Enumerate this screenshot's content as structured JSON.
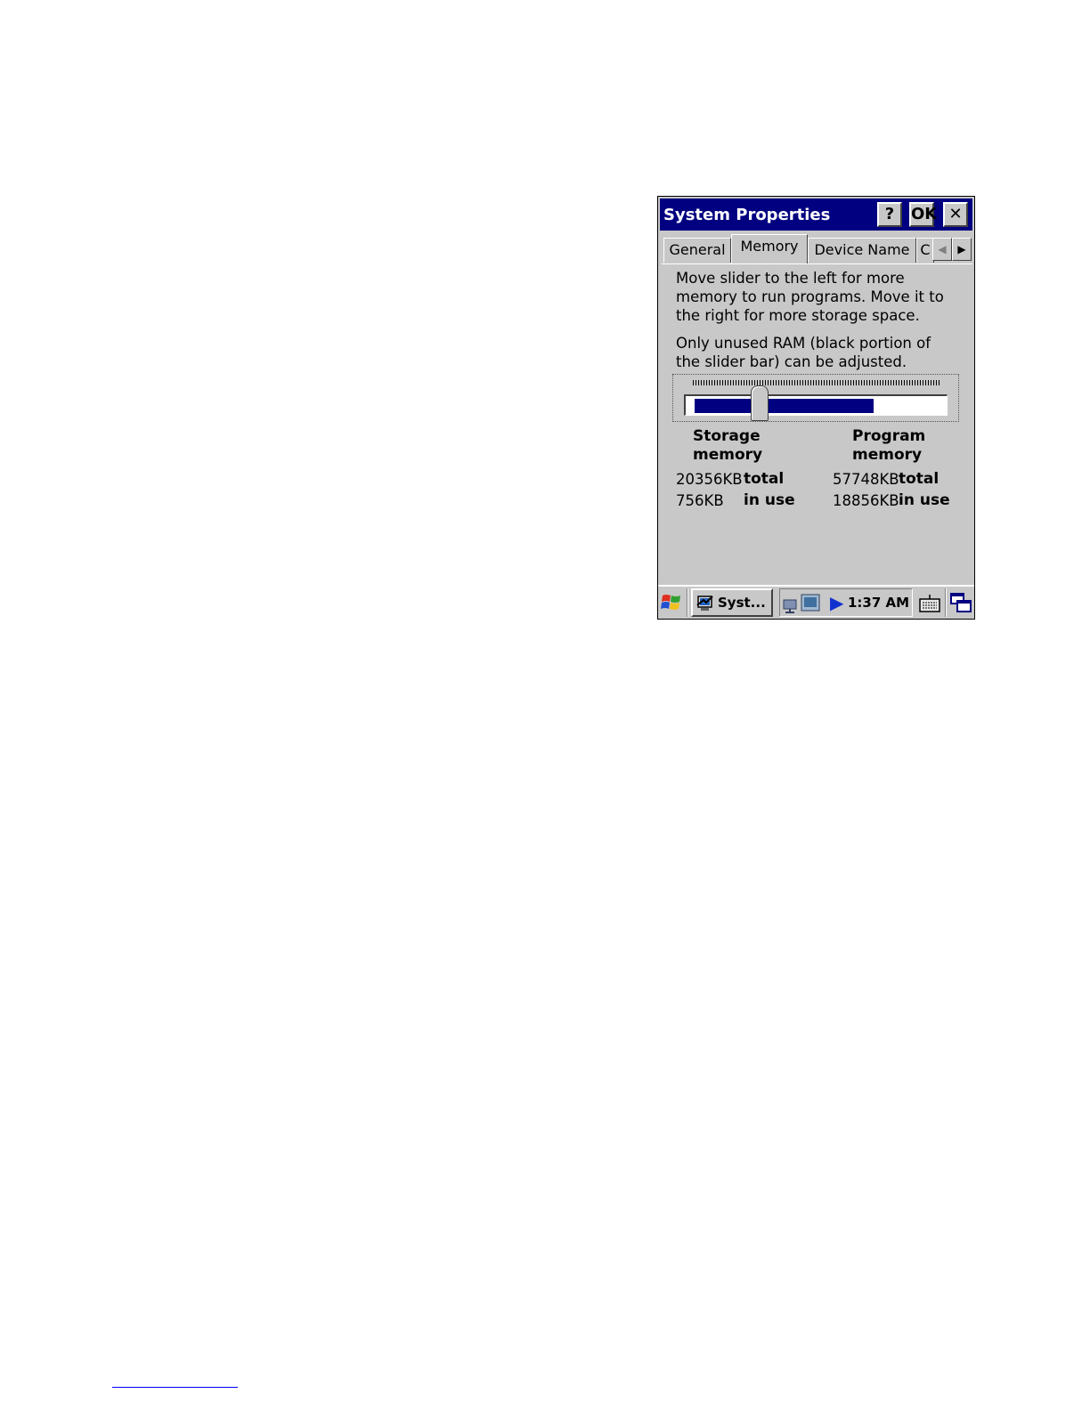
{
  "window": {
    "title": "System Properties",
    "help_button": "?",
    "ok_button": "OK",
    "close_button": "✕"
  },
  "tabs": [
    {
      "label": "General",
      "active": false
    },
    {
      "label": "Memory",
      "active": true
    },
    {
      "label": "Device Name",
      "active": false
    },
    {
      "label": "C",
      "active": false
    }
  ],
  "memory": {
    "instructions": [
      "Move slider to the left for more",
      "memory to run programs. Move it to",
      "the right for more storage space."
    ],
    "note": [
      "Only unused RAM (black portion of",
      "the slider bar) can be adjusted."
    ],
    "slider_position": 0.27,
    "used_fill": 0.73,
    "storage": {
      "heading_1": "Storage",
      "heading_2": "memory",
      "total": "20356KB",
      "in_use": "756KB"
    },
    "program": {
      "heading_1": "Program",
      "heading_2": "memory",
      "total": "57748KB",
      "in_use": "18856KB"
    },
    "total_label": "total",
    "in_use_label": "in use"
  },
  "taskbar": {
    "task_label": "Syst...",
    "clock": "1:37 AM"
  },
  "icons": {
    "start": "windows-flag-icon",
    "task": "system-properties-icon",
    "network": "network-icon",
    "tray_arrow": "tray-arrow-icon",
    "keyboard": "keyboard-icon",
    "desktop": "desktop-switch-icon"
  },
  "colors": {
    "titlebar": "#000080",
    "window_bg": "#c8c8c8",
    "slider_fill": "#000080"
  }
}
